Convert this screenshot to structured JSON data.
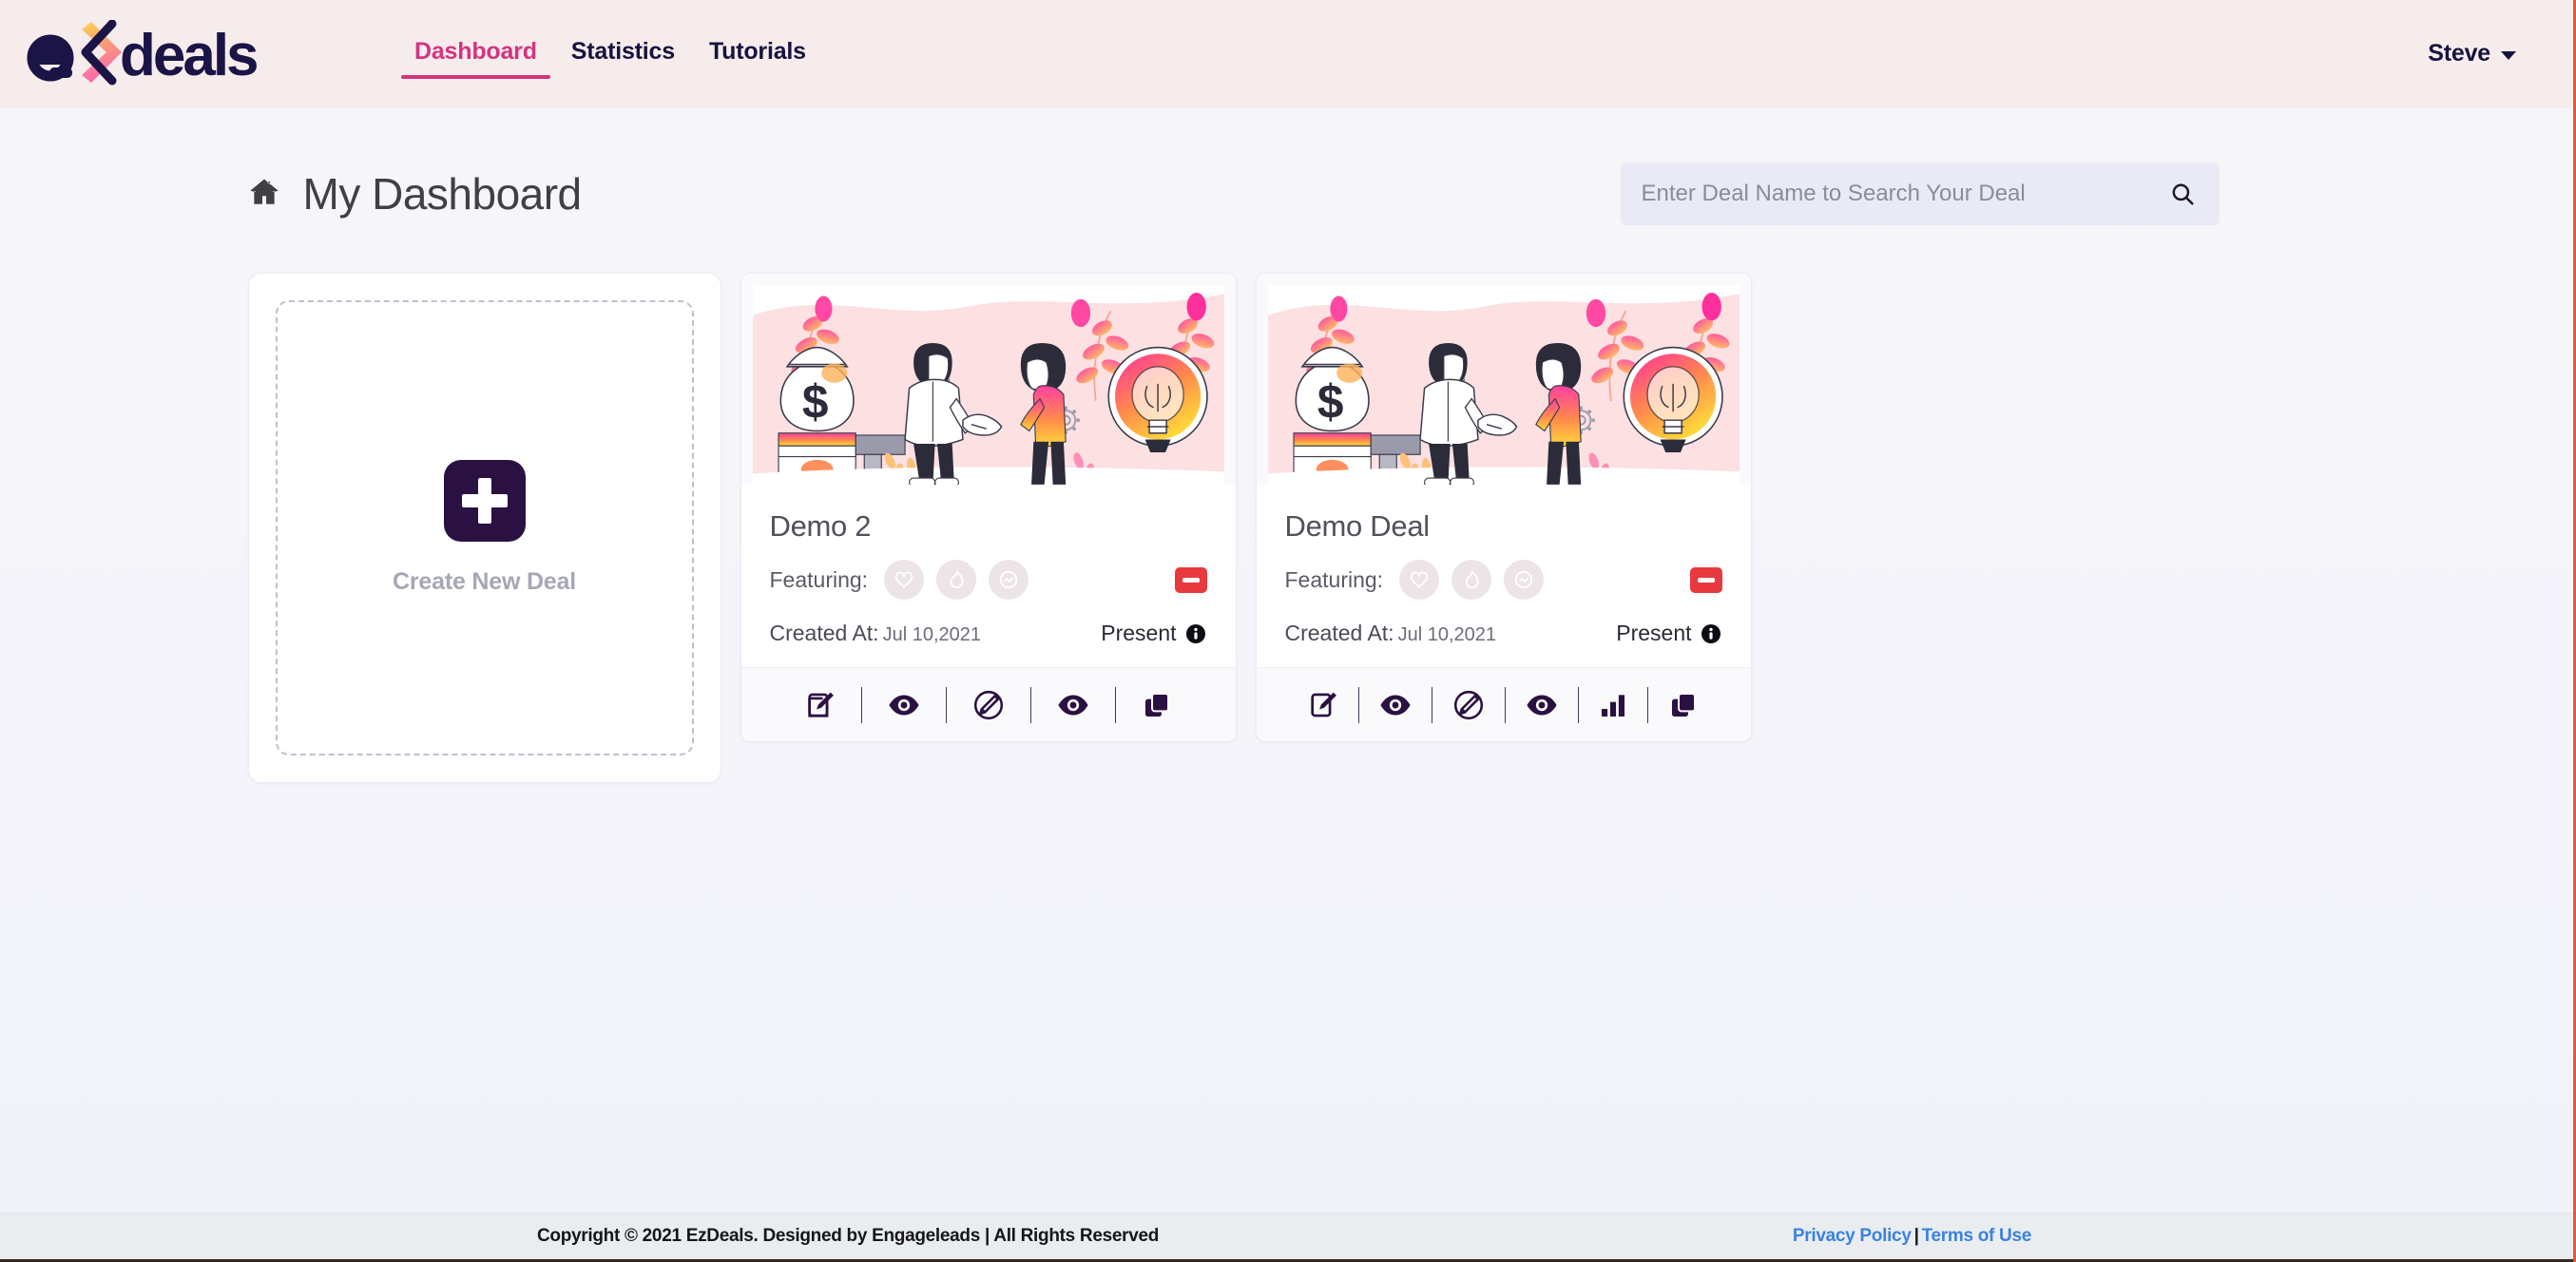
{
  "navbar": {
    "brand": {
      "name": "ezdeals-logo",
      "text_left": "e",
      "text_right": "deals"
    },
    "links": [
      {
        "label": "Dashboard",
        "active": true
      },
      {
        "label": "Statistics",
        "active": false
      },
      {
        "label": "Tutorials",
        "active": false
      }
    ],
    "user": {
      "name": "Steve"
    },
    "colors": {
      "background": "#f6ecec",
      "active_link": "#d6337f",
      "link": "#16133f"
    }
  },
  "header": {
    "title": "My Dashboard",
    "home_icon": "home-icon"
  },
  "search": {
    "placeholder": "Enter Deal Name to Search Your Deal",
    "value": "",
    "icon": "search-icon"
  },
  "create_card": {
    "label": "Create New Deal",
    "icon": "plus-icon",
    "icon_color": "#2b1042"
  },
  "deals": [
    {
      "name": "Demo 2",
      "featuring_label": "Featuring:",
      "featuring": [
        {
          "icon": "heart-icon",
          "label": "Favorite"
        },
        {
          "icon": "flame-icon",
          "label": "Hot"
        },
        {
          "icon": "trending-up-icon",
          "label": "Trending"
        }
      ],
      "remove_label": "",
      "remove_icon": "minus-icon",
      "remove_color": "#e8393f",
      "created_label": "Created At:",
      "created_date": "Jul 10,2021",
      "present_label": "Present",
      "present_icon": "info-icon",
      "actions": [
        {
          "icon": "edit-square-icon",
          "label": "Edit"
        },
        {
          "icon": "eye-icon",
          "label": "Preview"
        },
        {
          "icon": "pencil-circle-icon",
          "label": "Annotate"
        },
        {
          "icon": "eye-icon",
          "label": "View"
        },
        {
          "icon": "copy-icon",
          "label": "Duplicate"
        }
      ]
    },
    {
      "name": "Demo Deal",
      "featuring_label": "Featuring:",
      "featuring": [
        {
          "icon": "heart-icon",
          "label": "Favorite"
        },
        {
          "icon": "flame-icon",
          "label": "Hot"
        },
        {
          "icon": "trending-up-icon",
          "label": "Trending"
        }
      ],
      "remove_label": "",
      "remove_icon": "minus-icon",
      "remove_color": "#e8393f",
      "created_label": "Created At:",
      "created_date": "Jul 10,2021",
      "present_label": "Present",
      "present_icon": "info-icon",
      "actions": [
        {
          "icon": "edit-square-icon",
          "label": "Edit"
        },
        {
          "icon": "eye-icon",
          "label": "Preview"
        },
        {
          "icon": "pencil-circle-icon",
          "label": "Annotate"
        },
        {
          "icon": "eye-icon",
          "label": "View"
        },
        {
          "icon": "bar-chart-icon",
          "label": "Statistics"
        },
        {
          "icon": "copy-icon",
          "label": "Duplicate"
        }
      ]
    }
  ],
  "footer": {
    "copyright": "Copyright © 2021 EzDeals. Designed by Engageleads | All Rights Reserved",
    "privacy": "Privacy Policy",
    "separator": "|",
    "terms": "Terms of Use",
    "link_color": "#3b82e0"
  }
}
